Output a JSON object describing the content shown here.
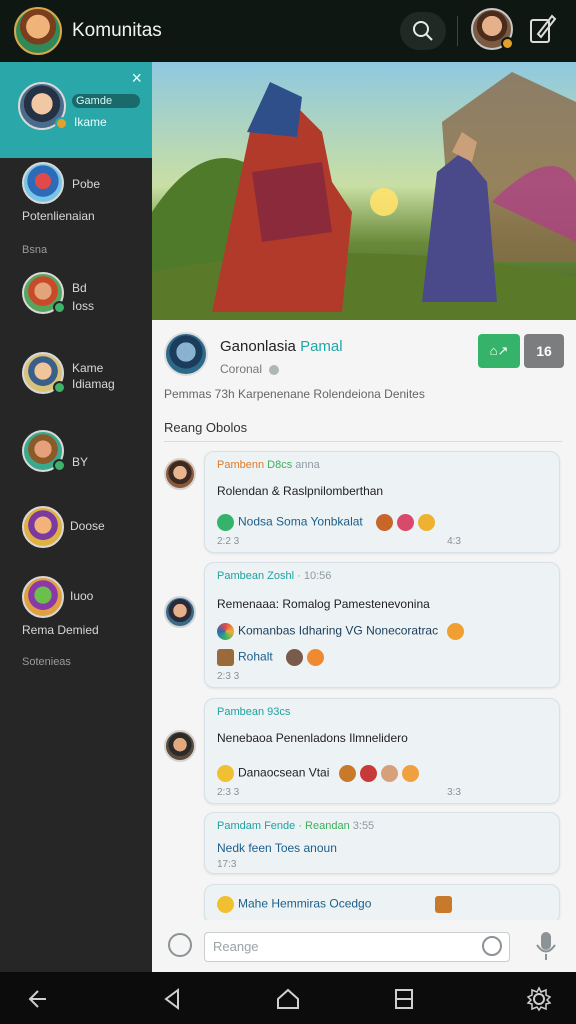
{
  "app": {
    "title": "Komunitas"
  },
  "sidebar": {
    "items": [
      {
        "line1": "Gamde",
        "line2": "Ikame",
        "badge": "online",
        "active": true
      },
      {
        "line1": "Pobe",
        "line2": "Potenlienaian"
      },
      {
        "line1": "Bsna"
      },
      {
        "line1": "Bd",
        "line2": "Ioss"
      },
      {
        "line1": "Kame",
        "line2": "Idiamag"
      },
      {
        "line1": "BY"
      },
      {
        "line1": "Doose"
      },
      {
        "line1": "Iuoo",
        "line2": "Rema Demied"
      },
      {
        "line1": "Sotenieas"
      }
    ],
    "close_label": "×"
  },
  "profile": {
    "name": "Ganonlasia",
    "name_highlight": "Pamal",
    "sub": "Coronal",
    "follow_label": "⌂↗",
    "count_label": "16",
    "description": "Pemmas  73h  Karpenenane  Rolendeiona  Denites"
  },
  "section": {
    "title": "Reang Obolos"
  },
  "messages": [
    {
      "header_a": "Pambenn",
      "header_b": "D8cs",
      "header_c": "anna",
      "body": "Rolendan  &  Raslpnilomberthan",
      "line": "Nodsa Soma Yonbkalat",
      "time_left": "2:2 3",
      "time_right": "4:3"
    },
    {
      "header_a": "Pambean  Zoshl",
      "header_b": "",
      "header_c": "· 10:56",
      "body": "Remenaaa:  Romalog  Pamestenevonina",
      "line": "Komanbas Idharing  VG    Nonecoratrac",
      "line2": "Rohalt",
      "time_left": "2:3 3",
      "time_right": ""
    },
    {
      "header_a": "Pambean  93cs",
      "header_b": "",
      "header_c": "",
      "body": "Nenebaoa  Penenladons  Ilmnelidero",
      "line": "Danaocsean      Vtai",
      "time_left": "2:3 3",
      "time_right": "3:3"
    },
    {
      "header_a": "Pamdam  Fende",
      "header_b": "·  Reandan",
      "header_c": "3:55",
      "body": "Nedk  feen  Toes anoun",
      "line": "",
      "time_left": "17:3",
      "time_right": ""
    },
    {
      "header_a": "",
      "header_b": "",
      "header_c": "",
      "body": "",
      "line": "Mahe  Hemmiras  Ocedgo",
      "time_left": "",
      "time_right": ""
    }
  ],
  "composer": {
    "placeholder": "Reange"
  },
  "colors": {
    "accent": "#2aa7a8",
    "green": "#36b36a",
    "sidebar": "#262626"
  },
  "icons": [
    "search-icon",
    "edit-icon",
    "close-icon",
    "back-icon",
    "home-icon",
    "recents-icon",
    "settings-icon",
    "smile-icon",
    "mic-icon"
  ]
}
